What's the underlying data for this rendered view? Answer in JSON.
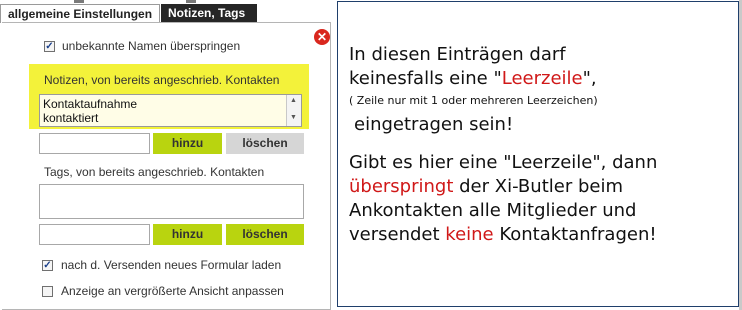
{
  "tabs": [
    {
      "label": "allgemeine Einstellungen",
      "active": true
    },
    {
      "label": "Notizen, Tags",
      "active": false
    }
  ],
  "settings": {
    "skip_unknown_label": "unbekannte Namen überspringen",
    "skip_unknown_checked": true,
    "notes_title": "Notizen, von bereits angeschrieb. Kontakten",
    "notes_items": [
      "Kontaktaufnahme",
      "kontaktiert"
    ],
    "notes_input_value": "",
    "add_label": "hinzu",
    "delete_label": "löschen",
    "tags_title": "Tags, von bereits angeschrieb. Kontakten",
    "tags_input_value": "",
    "reload_label": "nach d. Versenden neues Formular laden",
    "reload_checked": true,
    "zoom_label": "Anzeige an vergrößerte Ansicht anpassen",
    "zoom_checked": false
  },
  "note": {
    "l1": "In diesen Einträgen darf",
    "l2a": "keinesfalls eine \"",
    "l2b": "Leerzeile",
    "l2c": "\",",
    "l3": "( Zeile nur mit 1 oder mehreren  Leerzeichen)",
    "l4": "eingetragen sein!",
    "l5": "Gibt es hier eine \"Leerzeile\", dann",
    "l6a": "überspringt",
    "l6b": " der Xi-Butler beim",
    "l7": "Ankontakten alle Mitglieder und",
    "l8a": "versendet ",
    "l8b": "keine",
    "l8c": " Kontaktanfragen!"
  },
  "colors": {
    "highlight": "#f3f23a",
    "button_green": "#b9d40f",
    "button_gray": "#d6d6d6",
    "warning_red": "#d01818",
    "tab_dark": "#262626"
  },
  "icons": {
    "close": "close-icon",
    "scroll_up": "scroll-up-icon",
    "scroll_down": "scroll-down-icon"
  }
}
